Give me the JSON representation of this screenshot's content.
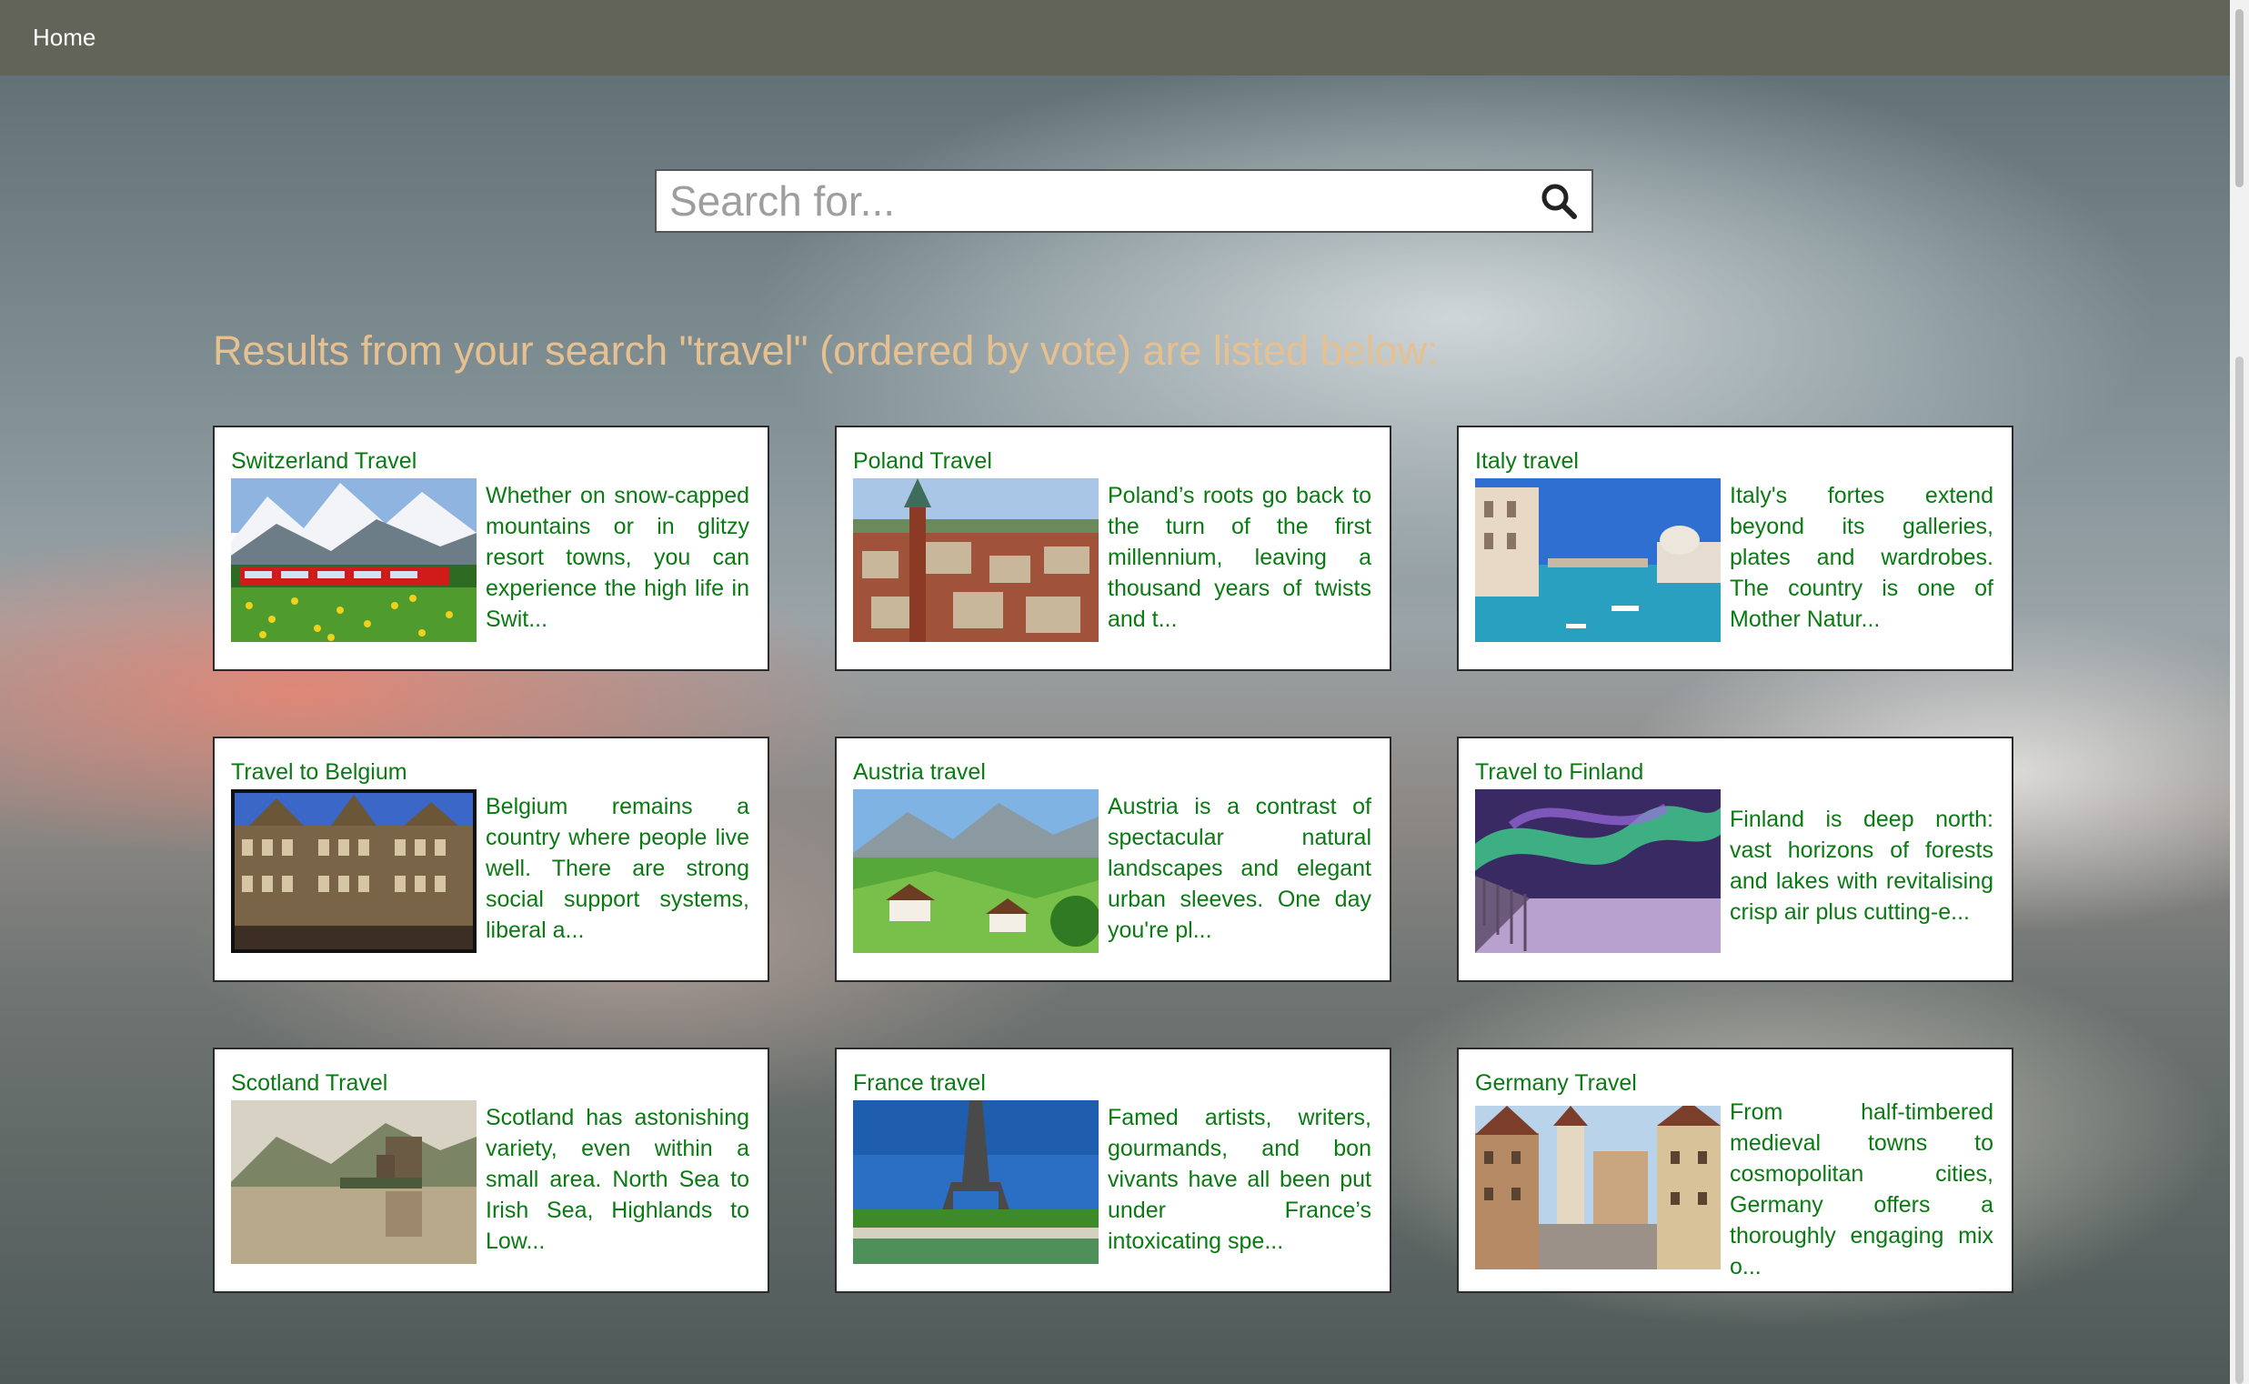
{
  "nav": {
    "home_label": "Home"
  },
  "search": {
    "placeholder": "Search for...",
    "value": ""
  },
  "results": {
    "heading": "Results from your search \"travel\" (ordered by vote) are listed below:",
    "items": [
      {
        "title": "Switzerland Travel",
        "description": "Whether on snow-capped mountains or in glitzy resort towns, you can experience the high life in Swit...",
        "image": "switzerland-train-photo"
      },
      {
        "title": "Poland Travel",
        "description": "Poland’s roots go back to the turn of the first millennium, leaving a thousand years of twists and t...",
        "image": "poland-town-photo"
      },
      {
        "title": "Italy travel",
        "description": "Italy's fortes extend beyond its galleries, plates and wardrobes. The country is one of Mother Natur...",
        "image": "italy-venice-photo"
      },
      {
        "title": "Travel to Belgium",
        "description": "Belgium remains a country where people live well. There are strong social support systems, liberal a...",
        "image": "belgium-grand-place-photo"
      },
      {
        "title": "Austria travel",
        "description": "Austria is a contrast of spectacular natural landscapes and elegant urban sleeves. One day you're pl...",
        "image": "austria-valley-photo"
      },
      {
        "title": "Travel to Finland",
        "description": "Finland is deep north: vast horizons of forests and lakes with revitalising crisp air plus cutting-e...",
        "image": "finland-aurora-photo"
      },
      {
        "title": "Scotland Travel",
        "description": "Scotland has astonishing variety, even within a small area. North Sea to Irish Sea, Highlands to Low...",
        "image": "scotland-castle-photo"
      },
      {
        "title": "France travel",
        "description": "Famed artists, writers, gourmands, and bon vivants have all been put under France’s intoxicating spe...",
        "image": "france-eiffel-photo"
      },
      {
        "title": "Germany Travel",
        "description": "From half-timbered medieval towns to cosmopolitan cities, Germany offers a thoroughly engaging mix o...",
        "image": "germany-old-town-photo"
      }
    ]
  },
  "colors": {
    "navbar": "#636459",
    "heading": "#e7c08f",
    "card_text": "#0a7a12",
    "card_border": "#2b2b2b"
  }
}
